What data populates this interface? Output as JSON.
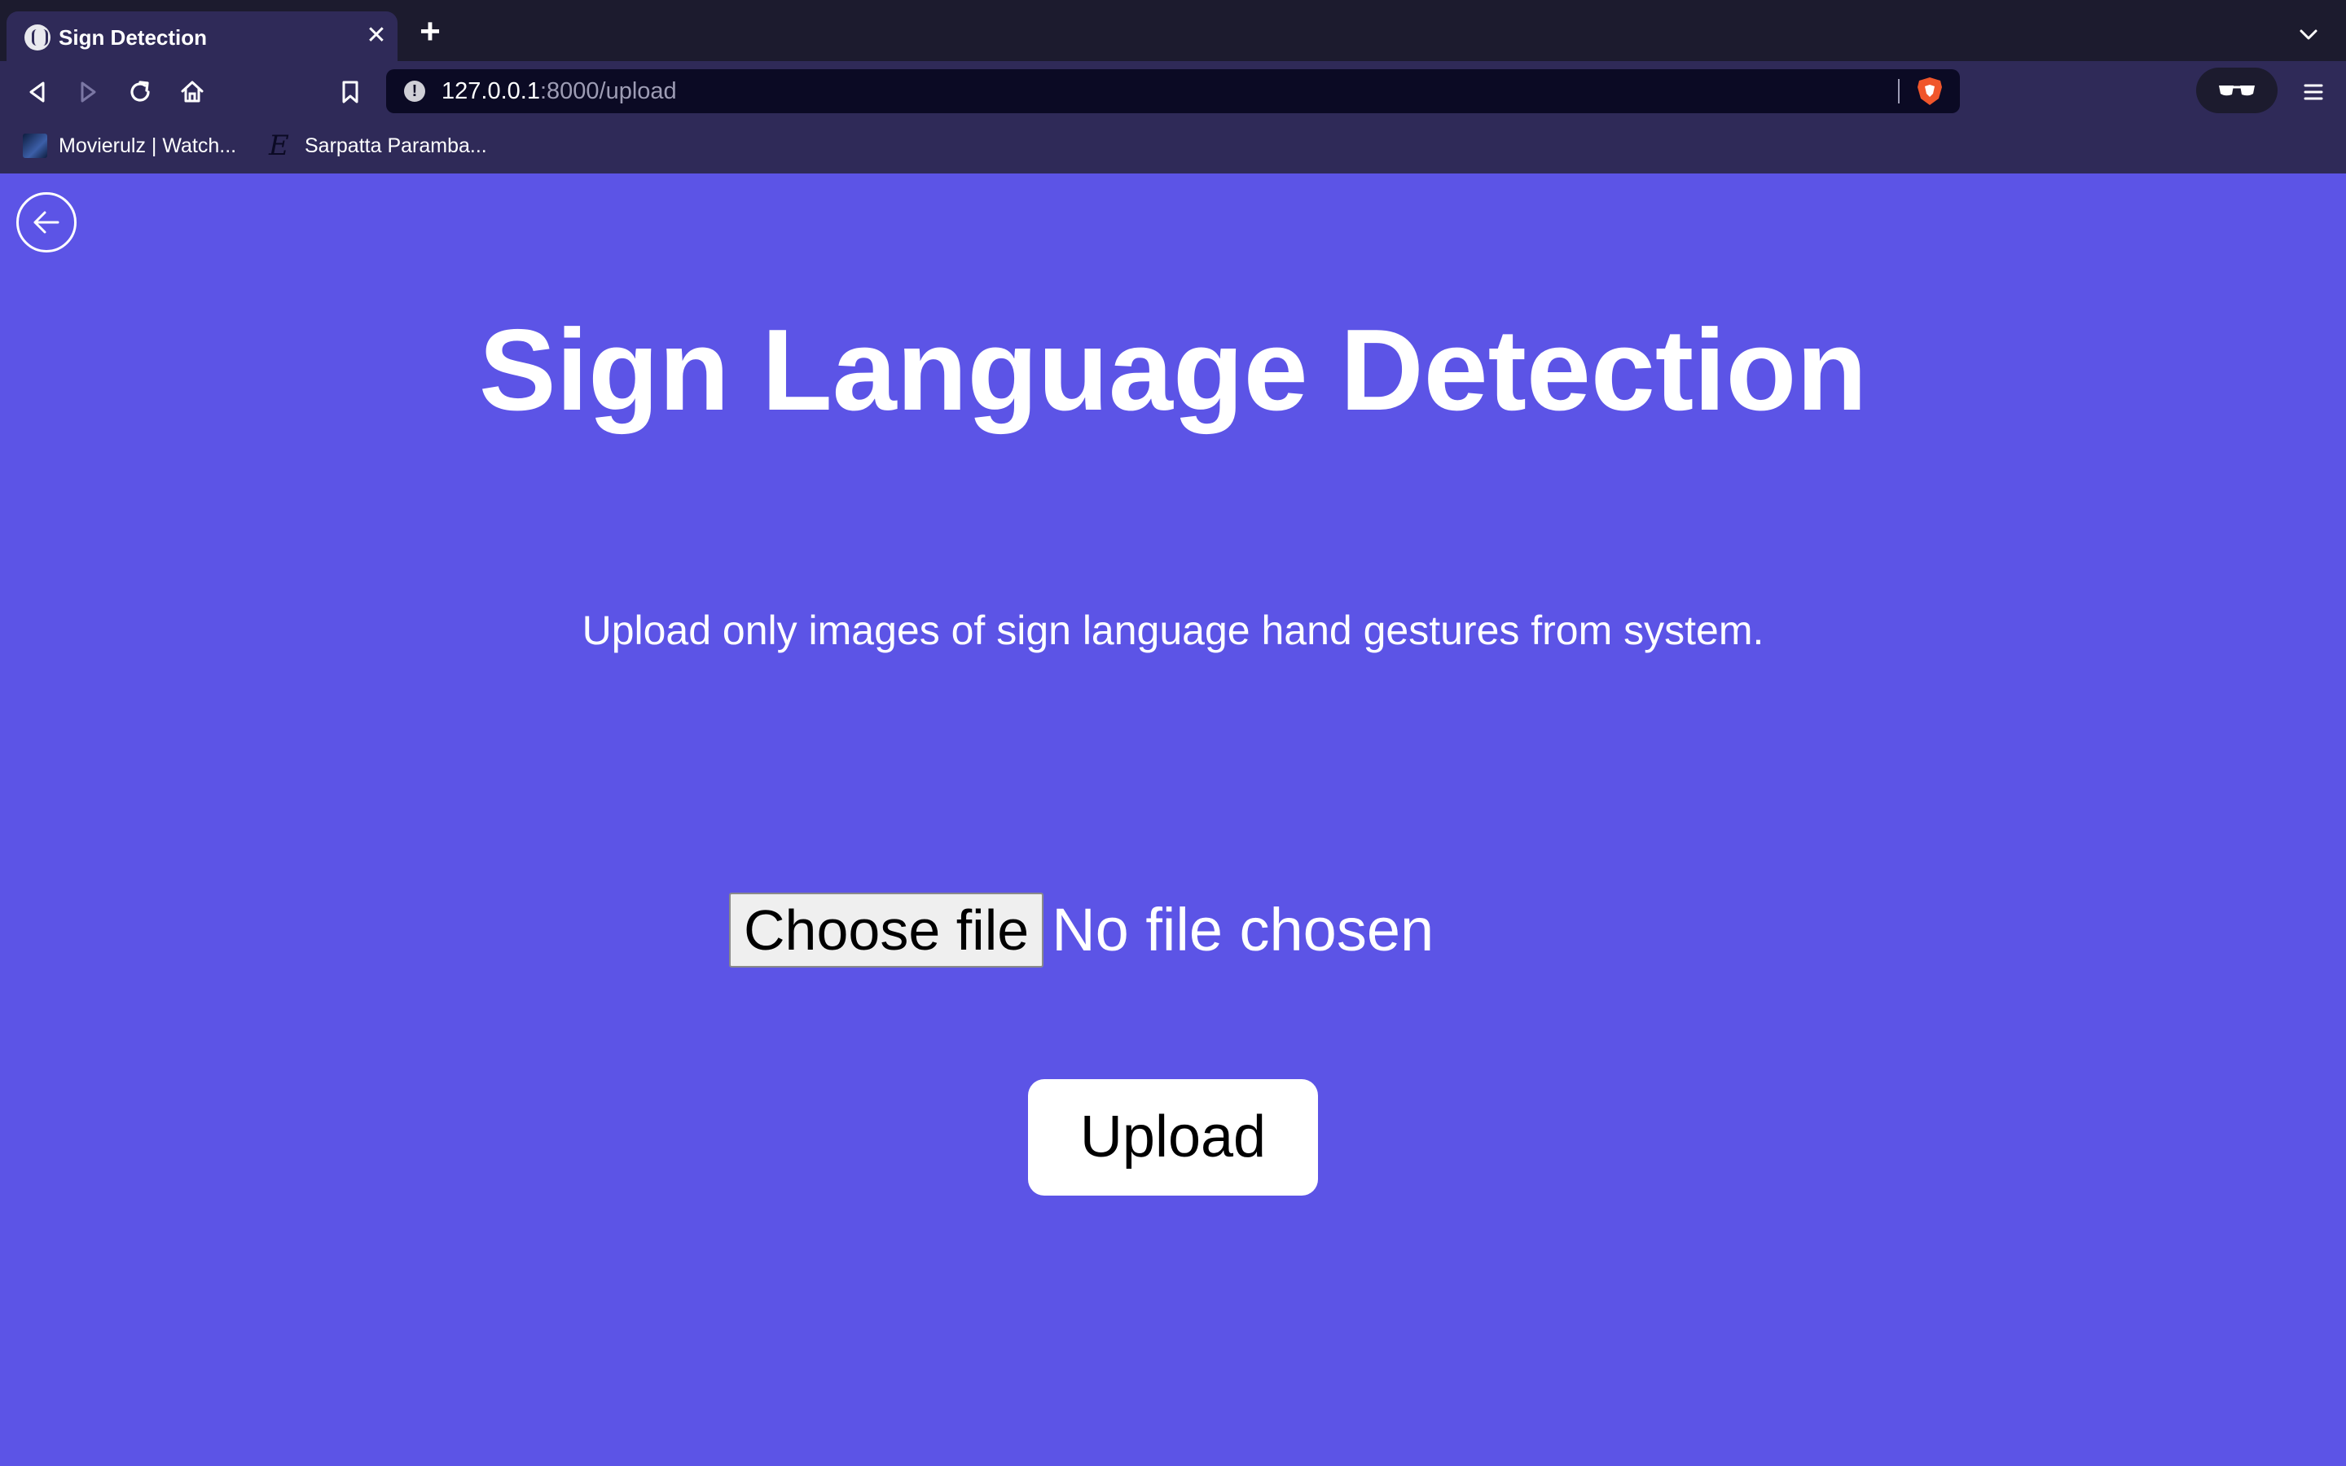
{
  "browser": {
    "tab": {
      "title": "Sign Detection",
      "close": "✕"
    },
    "new_tab": "+",
    "address": {
      "host": "127.0.0.1",
      "rest": ":8000/upload"
    },
    "bookmarks": [
      {
        "label": "Movierulz | Watch..."
      },
      {
        "label": "Sarpatta Paramba..."
      }
    ]
  },
  "page": {
    "title": "Sign Language Detection",
    "instructions": "Upload only images of sign language hand gestures from system.",
    "file_input": {
      "button_label": "Choose file",
      "status": "No file chosen"
    },
    "upload_label": "Upload"
  },
  "colors": {
    "page_background": "#5c54e6",
    "chrome_dark": "#1c1b2e",
    "chrome_toolbar": "#2f2a58",
    "urlbar": "#0b0a24",
    "text_primary": "#ffffff"
  },
  "icons": [
    "back-icon",
    "forward-icon",
    "reload-icon",
    "home-icon",
    "bookmark-icon",
    "site-info-icon",
    "brave-shield-icon",
    "private-glasses-icon",
    "menu-icon",
    "chevron-down-icon",
    "back-arrow-circle-icon"
  ]
}
